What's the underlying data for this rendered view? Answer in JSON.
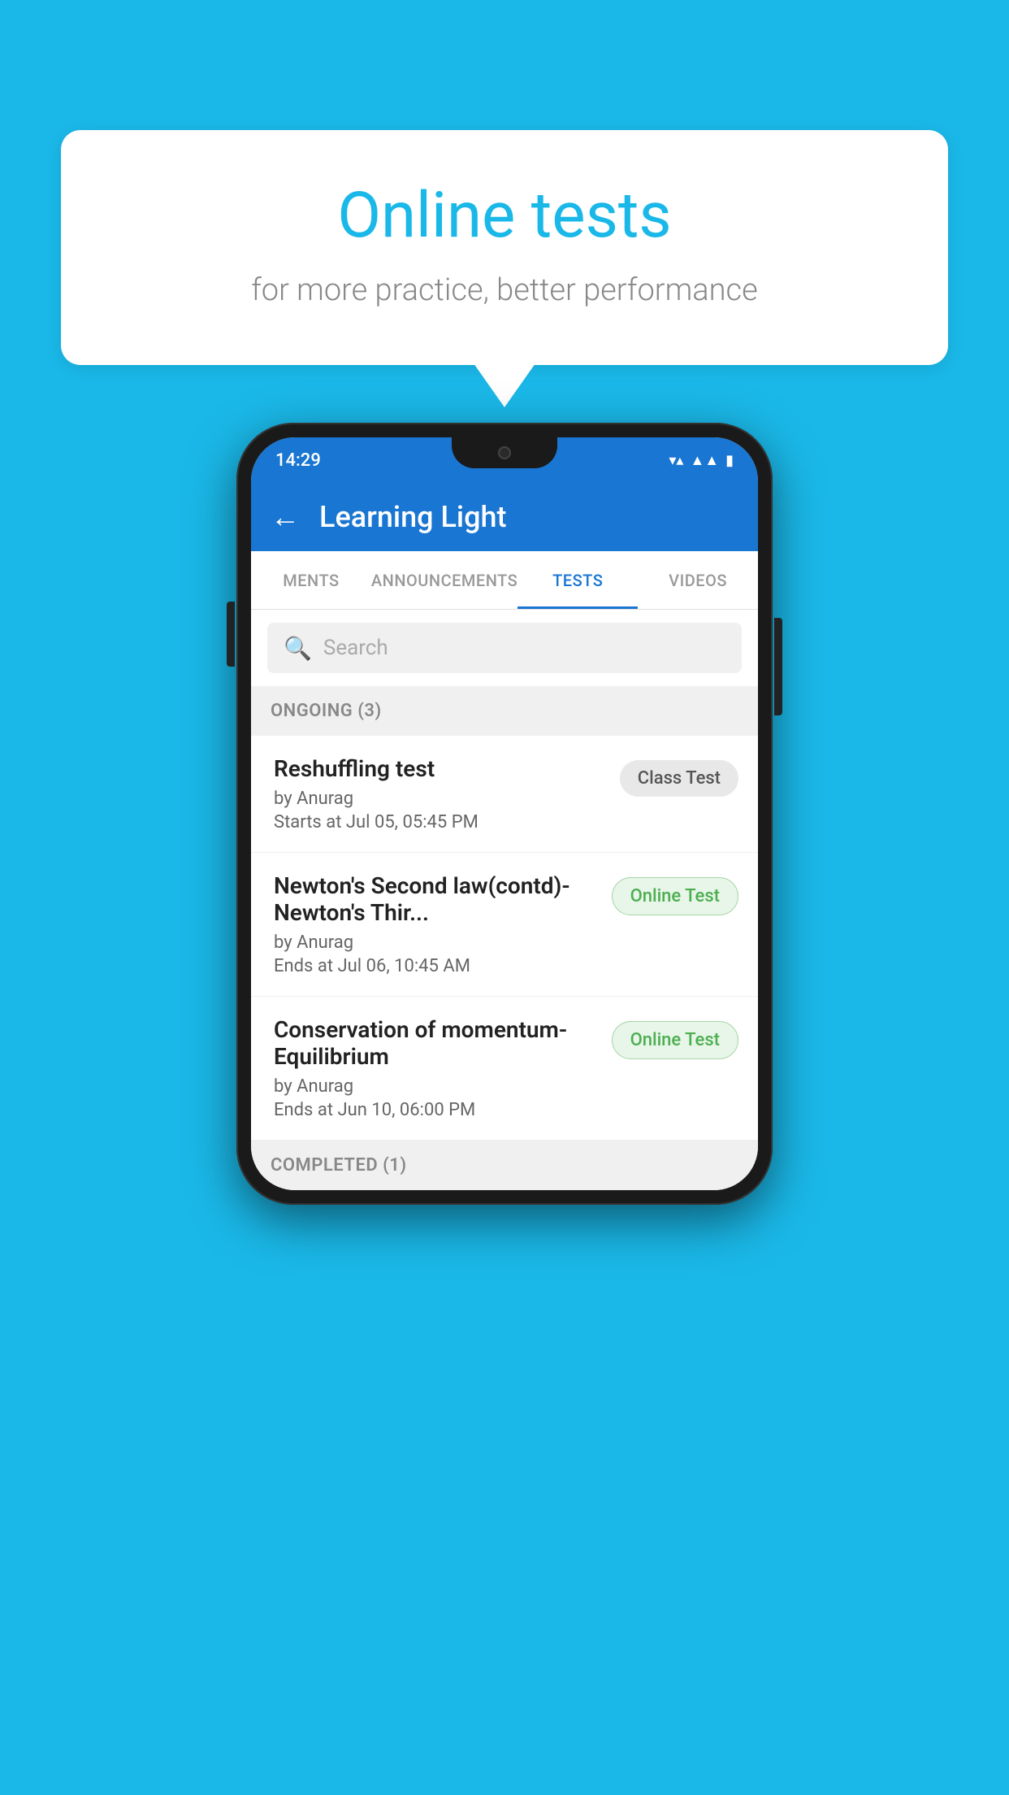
{
  "background_color": "#1ab8e8",
  "speech_bubble": {
    "title": "Online tests",
    "subtitle": "for more practice, better performance"
  },
  "phone": {
    "status_bar": {
      "time": "14:29",
      "wifi": "▼",
      "signal": "▲",
      "battery": "▮"
    },
    "app_bar": {
      "back_label": "←",
      "title": "Learning Light"
    },
    "tabs": [
      {
        "label": "MENTS",
        "active": false
      },
      {
        "label": "ANNOUNCEMENTS",
        "active": false
      },
      {
        "label": "TESTS",
        "active": true
      },
      {
        "label": "VIDEOS",
        "active": false
      }
    ],
    "search": {
      "placeholder": "Search"
    },
    "ongoing_section": {
      "header": "ONGOING (3)",
      "tests": [
        {
          "name": "Reshuffling test",
          "by": "by Anurag",
          "time_label": "Starts at",
          "time": "Jul 05, 05:45 PM",
          "badge": "Class Test",
          "badge_type": "class"
        },
        {
          "name": "Newton's Second law(contd)-Newton's Thir...",
          "by": "by Anurag",
          "time_label": "Ends at",
          "time": "Jul 06, 10:45 AM",
          "badge": "Online Test",
          "badge_type": "online"
        },
        {
          "name": "Conservation of momentum-Equilibrium",
          "by": "by Anurag",
          "time_label": "Ends at",
          "time": "Jun 10, 06:00 PM",
          "badge": "Online Test",
          "badge_type": "online"
        }
      ]
    },
    "completed_section": {
      "header": "COMPLETED (1)"
    }
  }
}
